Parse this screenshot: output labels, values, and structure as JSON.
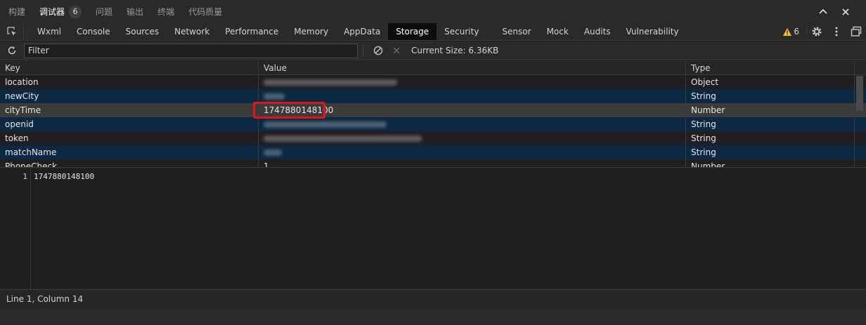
{
  "panel_tabs": [
    {
      "label": "构建"
    },
    {
      "label": "调试器",
      "badge": "6"
    },
    {
      "label": "问题"
    },
    {
      "label": "输出"
    },
    {
      "label": "终端"
    },
    {
      "label": "代码质量"
    }
  ],
  "devtools_tabs": [
    "Wxml",
    "Console",
    "Sources",
    "Network",
    "Performance",
    "Memory",
    "AppData",
    "Storage",
    "Security",
    "Sensor",
    "Mock",
    "Audits",
    "Vulnerability"
  ],
  "active_tab": "Storage",
  "warnings_count": "6",
  "toolbar": {
    "filter_placeholder": "Filter",
    "current_size": "Current Size: 6.36KB"
  },
  "table": {
    "headers": {
      "key": "Key",
      "value": "Value",
      "type": "Type"
    },
    "rows": [
      {
        "key": "location",
        "type": "Object"
      },
      {
        "key": "newCity",
        "type": "String"
      },
      {
        "key": "cityTime",
        "value": "1747880148100",
        "type": "Number"
      },
      {
        "key": "openid",
        "type": "String"
      },
      {
        "key": "token",
        "type": "String"
      },
      {
        "key": "matchName",
        "type": "String"
      },
      {
        "key": "PhoneCheck",
        "value": "1",
        "type": "Number"
      }
    ]
  },
  "editor": {
    "line_number": "1",
    "content": "1747880148100"
  },
  "status": {
    "cursor": "Line 1, Column 14"
  },
  "colors": {
    "selected_row": "#3b3b3b",
    "alt_row": "#0b2942",
    "highlight_box": "#e1141b",
    "warning": "#f5c518"
  }
}
